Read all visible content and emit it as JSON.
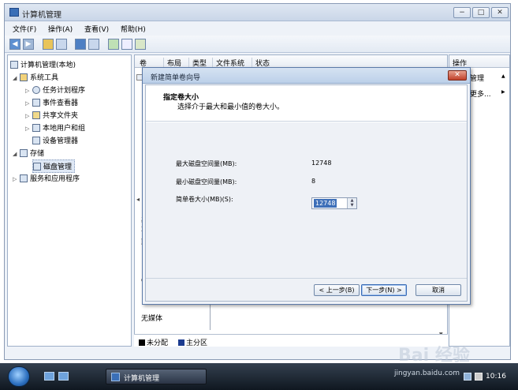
{
  "window": {
    "title": "计算机管理",
    "buttons": [
      "−",
      "□",
      "✕"
    ]
  },
  "menu": [
    "文件(F)",
    "操作(A)",
    "查看(V)",
    "帮助(H)"
  ],
  "toolbar": {
    "back": "◀",
    "forward": "▶"
  },
  "tree": {
    "root": "计算机管理(本地)",
    "system_tools": "系统工具",
    "task_scheduler": "任务计划程序",
    "event_viewer": "事件查看器",
    "shared_folders": "共享文件夹",
    "local_users": "本地用户和组",
    "device_manager": "设备管理器",
    "storage": "存储",
    "disk_management": "磁盘管理",
    "services_apps": "服务和应用程序"
  },
  "center": {
    "columns": [
      "卷",
      "布局",
      "类型",
      "文件系统",
      "状态"
    ],
    "partial_texts": [
      "基",
      "2",
      "联",
      "C"
    ],
    "no_media": "无媒体"
  },
  "legend": {
    "unallocated": "未分配",
    "primary": "主分区"
  },
  "actions": {
    "header": "操作",
    "item1": "管理",
    "item2": "更多...",
    "up_arrow": "▲",
    "right_arrow": "▶"
  },
  "dialog": {
    "title": "新建简单卷向导",
    "close": "✕",
    "heading": "指定卷大小",
    "subheading": "选择介于最大和最小值的卷大小。",
    "max_label": "最大磁盘空间量(MB):",
    "max_value": "12748",
    "min_label": "最小磁盘空间量(MB):",
    "min_value": "8",
    "size_label": "简单卷大小(MB)(S):",
    "size_value": "12748",
    "back_button": "< 上一步(B)",
    "next_button": "下一步(N) >",
    "cancel_button": "取消"
  },
  "taskbar": {
    "task": "计算机管理",
    "url": "jingyan.baidu.com",
    "clock": "10:16"
  },
  "watermark": "Bai 经验"
}
